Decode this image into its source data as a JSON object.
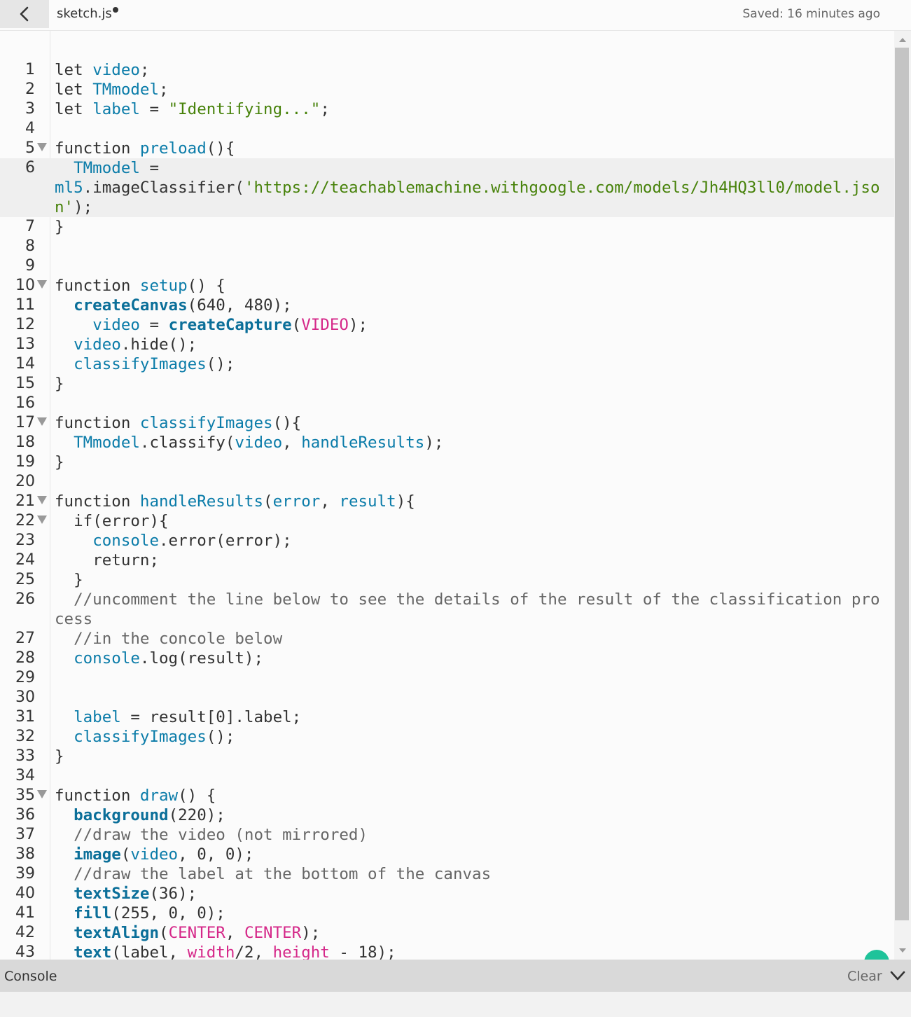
{
  "header": {
    "back_icon": "chevron-left-icon",
    "file_name": "sketch.js",
    "unsaved_indicator": "dot",
    "saved_status": "Saved: 16 minutes ago"
  },
  "editor": {
    "active_line": 6,
    "lines": [
      {
        "n": "1",
        "tokens": [
          [
            "kw",
            "let "
          ],
          [
            "def",
            "video"
          ],
          [
            "plain",
            ";"
          ]
        ]
      },
      {
        "n": "2",
        "tokens": [
          [
            "kw",
            "let "
          ],
          [
            "def",
            "TMmodel"
          ],
          [
            "plain",
            ";"
          ]
        ]
      },
      {
        "n": "3",
        "tokens": [
          [
            "kw",
            "let "
          ],
          [
            "def",
            "label"
          ],
          [
            "plain",
            " = "
          ],
          [
            "str",
            "\"Identifying...\""
          ],
          [
            "plain",
            ";"
          ]
        ]
      },
      {
        "n": "4",
        "tokens": []
      },
      {
        "n": "5",
        "fold": true,
        "tokens": [
          [
            "kw",
            "function "
          ],
          [
            "def",
            "preload"
          ],
          [
            "plain",
            "(){"
          ]
        ]
      },
      {
        "n": "6",
        "tokens": [
          [
            "plain",
            "  "
          ],
          [
            "var",
            "TMmodel"
          ],
          [
            "plain",
            " =\n"
          ],
          [
            "var",
            "ml5"
          ],
          [
            "plain",
            ".imageClassifier("
          ],
          [
            "str",
            "'https://teachablemachine.withgoogle.com/models/Jh4HQ3ll0/model.json'"
          ],
          [
            "plain",
            ");"
          ]
        ]
      },
      {
        "n": "7",
        "tokens": [
          [
            "plain",
            "}"
          ]
        ]
      },
      {
        "n": "8",
        "tokens": []
      },
      {
        "n": "9",
        "tokens": []
      },
      {
        "n": "10",
        "fold": true,
        "tokens": [
          [
            "kw",
            "function "
          ],
          [
            "def",
            "setup"
          ],
          [
            "plain",
            "() {"
          ]
        ]
      },
      {
        "n": "11",
        "tokens": [
          [
            "plain",
            "  "
          ],
          [
            "fn",
            "createCanvas"
          ],
          [
            "plain",
            "(640, 480);"
          ]
        ]
      },
      {
        "n": "12",
        "tokens": [
          [
            "plain",
            "    "
          ],
          [
            "var",
            "video"
          ],
          [
            "plain",
            " = "
          ],
          [
            "fn",
            "createCapture"
          ],
          [
            "plain",
            "("
          ],
          [
            "const",
            "VIDEO"
          ],
          [
            "plain",
            ");"
          ]
        ]
      },
      {
        "n": "13",
        "tokens": [
          [
            "plain",
            "  "
          ],
          [
            "var",
            "video"
          ],
          [
            "plain",
            ".hide();"
          ]
        ]
      },
      {
        "n": "14",
        "tokens": [
          [
            "plain",
            "  "
          ],
          [
            "var",
            "classifyImages"
          ],
          [
            "plain",
            "();"
          ]
        ]
      },
      {
        "n": "15",
        "tokens": [
          [
            "plain",
            "}"
          ]
        ]
      },
      {
        "n": "16",
        "tokens": []
      },
      {
        "n": "17",
        "fold": true,
        "tokens": [
          [
            "kw",
            "function "
          ],
          [
            "def",
            "classifyImages"
          ],
          [
            "plain",
            "(){"
          ]
        ]
      },
      {
        "n": "18",
        "tokens": [
          [
            "plain",
            "  "
          ],
          [
            "var",
            "TMmodel"
          ],
          [
            "plain",
            ".classify("
          ],
          [
            "var",
            "video"
          ],
          [
            "plain",
            ", "
          ],
          [
            "var",
            "handleResults"
          ],
          [
            "plain",
            ");"
          ]
        ]
      },
      {
        "n": "19",
        "tokens": [
          [
            "plain",
            "}"
          ]
        ]
      },
      {
        "n": "20",
        "tokens": []
      },
      {
        "n": "21",
        "fold": true,
        "tokens": [
          [
            "kw",
            "function "
          ],
          [
            "def",
            "handleResults"
          ],
          [
            "plain",
            "("
          ],
          [
            "def",
            "error"
          ],
          [
            "plain",
            ", "
          ],
          [
            "def",
            "result"
          ],
          [
            "plain",
            "){"
          ]
        ]
      },
      {
        "n": "22",
        "fold": true,
        "tokens": [
          [
            "plain",
            "  "
          ],
          [
            "kw",
            "if"
          ],
          [
            "plain",
            "(error){"
          ]
        ]
      },
      {
        "n": "23",
        "tokens": [
          [
            "plain",
            "    "
          ],
          [
            "var",
            "console"
          ],
          [
            "plain",
            ".error(error);"
          ]
        ]
      },
      {
        "n": "24",
        "tokens": [
          [
            "plain",
            "    "
          ],
          [
            "kw",
            "return"
          ],
          [
            "plain",
            ";"
          ]
        ]
      },
      {
        "n": "25",
        "tokens": [
          [
            "plain",
            "  }"
          ]
        ]
      },
      {
        "n": "26",
        "tokens": [
          [
            "plain",
            "  "
          ],
          [
            "com",
            "//uncomment the line below to see the details of the result of the classification process"
          ]
        ]
      },
      {
        "n": "27",
        "tokens": [
          [
            "plain",
            "  "
          ],
          [
            "com",
            "//in the concole below"
          ]
        ]
      },
      {
        "n": "28",
        "tokens": [
          [
            "plain",
            "  "
          ],
          [
            "var",
            "console"
          ],
          [
            "plain",
            ".log(result);"
          ]
        ]
      },
      {
        "n": "29",
        "tokens": []
      },
      {
        "n": "30",
        "tokens": []
      },
      {
        "n": "31",
        "tokens": [
          [
            "plain",
            "  "
          ],
          [
            "var",
            "label"
          ],
          [
            "plain",
            " = result[0].label;"
          ]
        ]
      },
      {
        "n": "32",
        "tokens": [
          [
            "plain",
            "  "
          ],
          [
            "var",
            "classifyImages"
          ],
          [
            "plain",
            "();"
          ]
        ]
      },
      {
        "n": "33",
        "tokens": [
          [
            "plain",
            "}"
          ]
        ]
      },
      {
        "n": "34",
        "tokens": []
      },
      {
        "n": "35",
        "fold": true,
        "tokens": [
          [
            "kw",
            "function "
          ],
          [
            "def",
            "draw"
          ],
          [
            "plain",
            "() {"
          ]
        ]
      },
      {
        "n": "36",
        "tokens": [
          [
            "plain",
            "  "
          ],
          [
            "fn",
            "background"
          ],
          [
            "plain",
            "(220);"
          ]
        ]
      },
      {
        "n": "37",
        "tokens": [
          [
            "plain",
            "  "
          ],
          [
            "com",
            "//draw the video (not mirrored)"
          ]
        ]
      },
      {
        "n": "38",
        "tokens": [
          [
            "plain",
            "  "
          ],
          [
            "fn",
            "image"
          ],
          [
            "plain",
            "("
          ],
          [
            "var",
            "video"
          ],
          [
            "plain",
            ", 0, 0);"
          ]
        ]
      },
      {
        "n": "39",
        "tokens": [
          [
            "plain",
            "  "
          ],
          [
            "com",
            "//draw the label at the bottom of the canvas"
          ]
        ]
      },
      {
        "n": "40",
        "tokens": [
          [
            "plain",
            "  "
          ],
          [
            "fn",
            "textSize"
          ],
          [
            "plain",
            "(36);"
          ]
        ]
      },
      {
        "n": "41",
        "tokens": [
          [
            "plain",
            "  "
          ],
          [
            "fn",
            "fill"
          ],
          [
            "plain",
            "(255, 0, 0);"
          ]
        ]
      },
      {
        "n": "42",
        "tokens": [
          [
            "plain",
            "  "
          ],
          [
            "fn",
            "textAlign"
          ],
          [
            "plain",
            "("
          ],
          [
            "const",
            "CENTER"
          ],
          [
            "plain",
            ", "
          ],
          [
            "const",
            "CENTER"
          ],
          [
            "plain",
            ");"
          ]
        ]
      },
      {
        "n": "43",
        "tokens": [
          [
            "plain",
            "  "
          ],
          [
            "fn",
            "text"
          ],
          [
            "plain",
            "(label, "
          ],
          [
            "const",
            "width"
          ],
          [
            "plain",
            "/2, "
          ],
          [
            "const",
            "height"
          ],
          [
            "plain",
            " - 18);"
          ]
        ]
      }
    ]
  },
  "console": {
    "label": "Console",
    "clear_label": "Clear",
    "collapse_icon": "chevron-down-icon"
  },
  "colors": {
    "keyword": "#333333",
    "definition": "#0b7ca9",
    "builtin_function": "#0b6f99",
    "string": "#47820a",
    "constant": "#d52889",
    "comment": "#666666"
  }
}
